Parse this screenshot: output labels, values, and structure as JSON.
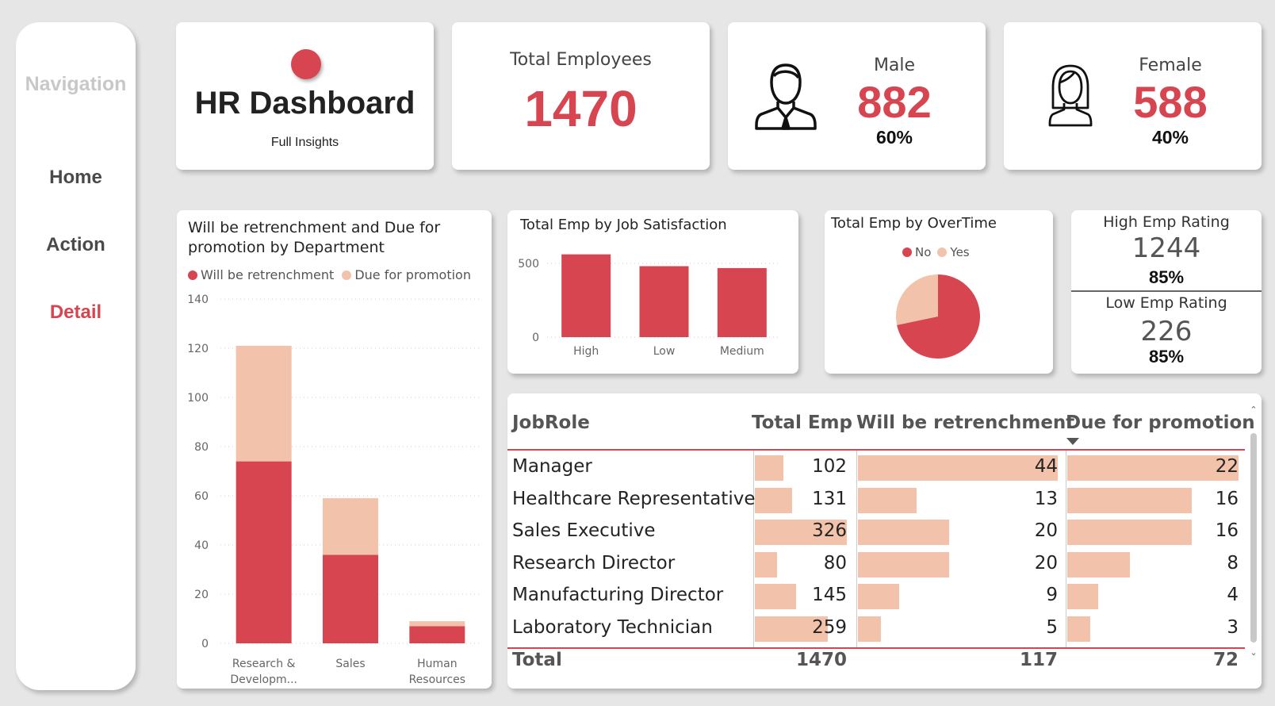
{
  "nav": {
    "title": "Navigation",
    "items": [
      {
        "label": "Home",
        "active": false
      },
      {
        "label": "Action",
        "active": false
      },
      {
        "label": "Detail",
        "active": true
      }
    ]
  },
  "header": {
    "title": "HR Dashboard",
    "subtitle": "Full Insights"
  },
  "kpis": {
    "total": {
      "label": "Total Employees",
      "value": "1470"
    },
    "male": {
      "label": "Male",
      "value": "882",
      "pct": "60%",
      "icon": "male-user-icon"
    },
    "female": {
      "label": "Female",
      "value": "588",
      "pct": "40%",
      "icon": "female-user-icon"
    }
  },
  "rating": {
    "high": {
      "label": "High Emp Rating",
      "value": "1244",
      "pct": "85%"
    },
    "low": {
      "label": "Low Emp Rating",
      "value": "226",
      "pct": "85%"
    }
  },
  "colors": {
    "primary": "#d64550",
    "secondary": "#f2c2aa"
  },
  "chart_data": [
    {
      "type": "bar",
      "stacked": true,
      "title": "Will be retrenchment and Due for promotion by Department",
      "categories": [
        "Research & Developm...",
        "Sales",
        "Human Resources"
      ],
      "series": [
        {
          "name": "Will be retrenchment",
          "values": [
            74,
            36,
            7
          ],
          "color": "#d64550"
        },
        {
          "name": "Due for promotion",
          "values": [
            47,
            23,
            2
          ],
          "color": "#f2c2aa"
        }
      ],
      "yticks": [
        "0",
        "20",
        "40",
        "60",
        "80",
        "100",
        "120",
        "140"
      ],
      "ylim": [
        0,
        140
      ],
      "grid": true,
      "legend": "top-left"
    },
    {
      "type": "bar",
      "title": "Total Emp by Job Satisfaction",
      "categories": [
        "High",
        "Low",
        "Medium"
      ],
      "values": [
        561,
        481,
        468
      ],
      "yticks": [
        "0",
        "500"
      ],
      "ylim": [
        0,
        600
      ],
      "grid": true
    },
    {
      "type": "pie",
      "title": "Total Emp by OverTime",
      "labels": [
        "No",
        "Yes"
      ],
      "values": [
        1054,
        416
      ],
      "colors": [
        "#d64550",
        "#f2c2aa"
      ],
      "legend": "top"
    },
    {
      "type": "table",
      "columns": [
        "JobRole",
        "Total Emp",
        "Will be retrenchment",
        "Due for promotion"
      ],
      "rows": [
        [
          "Manager",
          "102",
          "44",
          "22"
        ],
        [
          "Healthcare Representative",
          "131",
          "13",
          "16"
        ],
        [
          "Sales Executive",
          "326",
          "20",
          "16"
        ],
        [
          "Research Director",
          "80",
          "20",
          "8"
        ],
        [
          "Manufacturing Director",
          "145",
          "9",
          "4"
        ],
        [
          "Laboratory Technician",
          "259",
          "5",
          "3"
        ]
      ],
      "total": [
        "Total",
        "1470",
        "117",
        "72"
      ]
    }
  ]
}
